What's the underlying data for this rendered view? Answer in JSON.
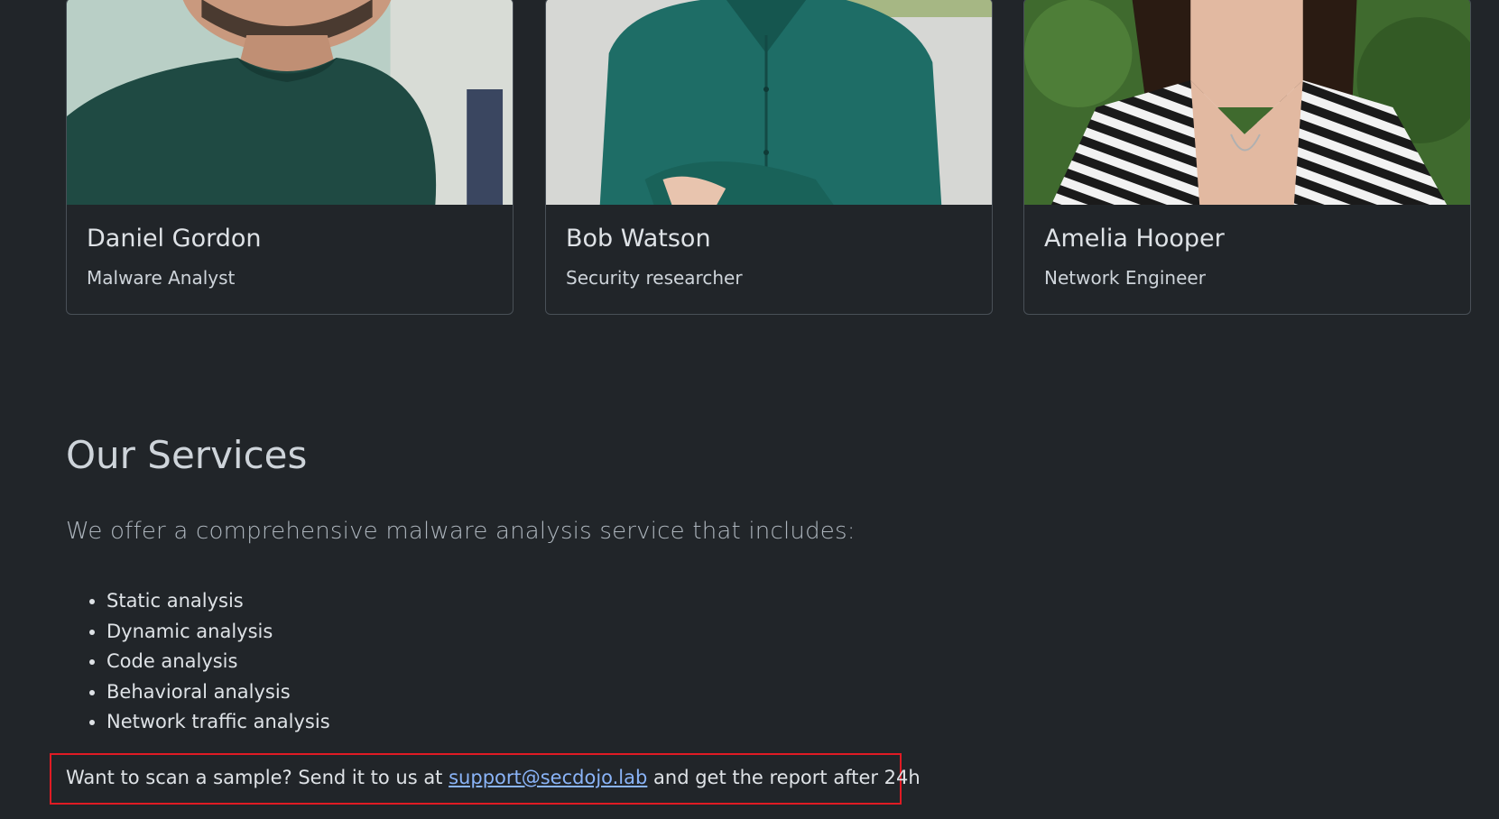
{
  "team": [
    {
      "name": "Daniel Gordon",
      "role": "Malware Analyst"
    },
    {
      "name": "Bob Watson",
      "role": "Security researcher"
    },
    {
      "name": "Amelia Hooper",
      "role": "Network Engineer"
    }
  ],
  "services": {
    "title": "Our Services",
    "lead": "We offer a comprehensive malware analysis service that includes:",
    "items": [
      "Static analysis",
      "Dynamic analysis",
      "Code analysis",
      "Behavioral analysis",
      "Network traffic analysis"
    ]
  },
  "cta": {
    "before": "Want to scan a sample? Send it to us at",
    "email": "support@secdojo.lab",
    "after": "and get the report after 24h"
  },
  "colors": {
    "background": "#212529",
    "highlight_border": "#e01b24",
    "link": "#8ab4f8"
  }
}
